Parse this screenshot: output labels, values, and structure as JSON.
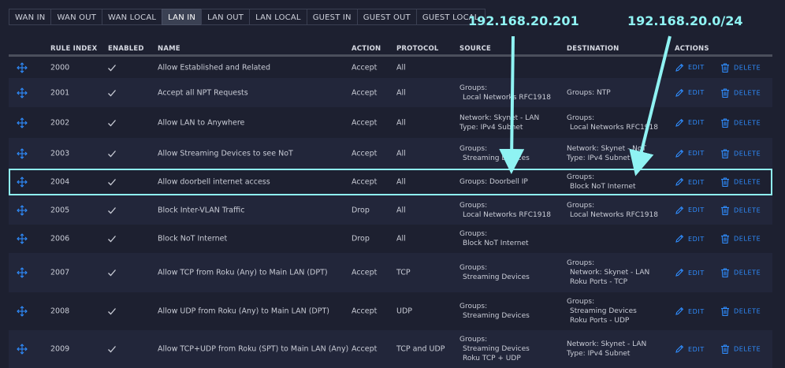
{
  "tabs": [
    {
      "label": "WAN IN",
      "active": false
    },
    {
      "label": "WAN OUT",
      "active": false
    },
    {
      "label": "WAN LOCAL",
      "active": false
    },
    {
      "label": "LAN IN",
      "active": true
    },
    {
      "label": "LAN OUT",
      "active": false
    },
    {
      "label": "LAN LOCAL",
      "active": false
    },
    {
      "label": "GUEST IN",
      "active": false
    },
    {
      "label": "GUEST OUT",
      "active": false
    },
    {
      "label": "GUEST LOCAL",
      "active": false
    }
  ],
  "annotations": {
    "source_ip": "192.168.20.201",
    "destination_subnet": "192.168.20.0/24"
  },
  "columns": {
    "rule_index": "RULE INDEX",
    "enabled": "ENABLED",
    "name": "NAME",
    "action": "ACTION",
    "protocol": "PROTOCOL",
    "source": "SOURCE",
    "destination": "DESTINATION",
    "actions": "ACTIONS"
  },
  "row_actions": {
    "edit": "EDIT",
    "delete": "DELETE"
  },
  "accent_color": "#2f8dff",
  "highlight_color": "#8ff3f3",
  "rows": [
    {
      "index": "2000",
      "name": "Allow Established and Related",
      "action": "Accept",
      "protocol": "All",
      "source": [],
      "destination": []
    },
    {
      "index": "2001",
      "name": "Accept all NPT Requests",
      "action": "Accept",
      "protocol": "All",
      "source": [
        "Groups:",
        "Local Networks RFC1918"
      ],
      "destination": [
        "Groups:  NTP"
      ]
    },
    {
      "index": "2002",
      "name": "Allow LAN to Anywhere",
      "action": "Accept",
      "protocol": "All",
      "source": [
        "Network: Skynet - LAN",
        "Type: IPv4 Subnet"
      ],
      "destination": [
        "Groups:",
        "Local Networks RFC1918"
      ]
    },
    {
      "index": "2003",
      "name": "Allow Streaming Devices to see NoT",
      "action": "Accept",
      "protocol": "All",
      "source": [
        "Groups:",
        "Streaming Devices"
      ],
      "destination": [
        "Network: Skynet - NoT",
        "Type: IPv4 Subnet"
      ]
    },
    {
      "index": "2004",
      "name": "Allow doorbell internet access",
      "action": "Accept",
      "protocol": "All",
      "source": [
        "Groups:  Doorbell IP"
      ],
      "destination": [
        "Groups:",
        "Block NoT Internet"
      ],
      "highlighted": true
    },
    {
      "index": "2005",
      "name": "Block Inter-VLAN Traffic",
      "action": "Drop",
      "protocol": "All",
      "source": [
        "Groups:",
        "Local Networks RFC1918"
      ],
      "destination": [
        "Groups:",
        "Local Networks RFC1918"
      ]
    },
    {
      "index": "2006",
      "name": "Block NoT Internet",
      "action": "Drop",
      "protocol": "All",
      "source": [
        "Groups:",
        "Block NoT Internet"
      ],
      "destination": []
    },
    {
      "index": "2007",
      "name": "Allow TCP from Roku (Any) to Main LAN (DPT)",
      "action": "Accept",
      "protocol": "TCP",
      "source": [
        "Groups:",
        "Streaming Devices"
      ],
      "destination": [
        "Groups:",
        "Network: Skynet - LAN",
        "Roku Ports - TCP"
      ]
    },
    {
      "index": "2008",
      "name": "Allow UDP from Roku (Any) to Main LAN (DPT)",
      "action": "Accept",
      "protocol": "UDP",
      "source": [
        "Groups:",
        "Streaming Devices"
      ],
      "destination": [
        "Groups:",
        "Streaming Devices",
        "Roku Ports - UDP"
      ]
    },
    {
      "index": "2009",
      "name": "Allow TCP+UDP from Roku (SPT) to Main LAN (Any)",
      "action": "Accept",
      "protocol": "TCP and UDP",
      "source": [
        "Groups:",
        "Streaming Devices",
        "Roku TCP + UDP"
      ],
      "destination": [
        "Network: Skynet - LAN",
        "Type: IPv4 Subnet"
      ]
    }
  ]
}
